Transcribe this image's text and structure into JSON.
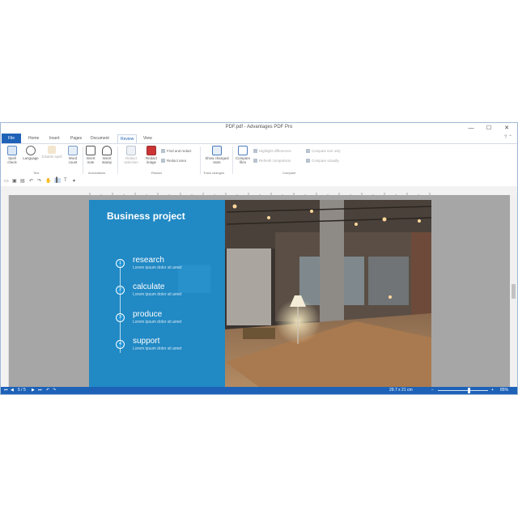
{
  "window": {
    "title": "PDF.pdf - Advantages PDF Pro",
    "controls": [
      "—",
      "☐",
      "✕"
    ]
  },
  "tabs": [
    "File",
    "Home",
    "Insert",
    "Pages",
    "Document",
    "Review",
    "View"
  ],
  "active_tab": "Review",
  "ribbon": {
    "spell_check": "Spell check",
    "language": "Language",
    "disable_spell": "Disable spell",
    "word_count": "Word count",
    "insert_note": "Insert note",
    "insert_stamp": "Insert stamp",
    "redact_selection": "Redact selection",
    "redact_image": "Redact image",
    "find_and_redact": "Find and redact",
    "redact_area": "Redact area",
    "show_changes": "Show changed texts",
    "compare_files": "Compare files",
    "highlight_differences": "Highlight differences",
    "refresh_comparison": "Refresh comparison",
    "compare_text_only": "Compare text only",
    "compare_visually": "Compare visually",
    "groups": {
      "text": "Text",
      "annotations": "Annotations",
      "redact": "Redact",
      "track_changes": "Track changes",
      "compare": "Compare"
    }
  },
  "document": {
    "title": "Business project",
    "steps": [
      {
        "num": "1",
        "heading": "research",
        "sub": "Lorem ipsum dolor sit amet"
      },
      {
        "num": "2",
        "heading": "calculate",
        "sub": "Lorem ipsum dolor sit amet"
      },
      {
        "num": "3",
        "heading": "produce",
        "sub": "Lorem ipsum dolor sit amet"
      },
      {
        "num": "4",
        "heading": "support",
        "sub": "Lorem ipsum dolor sit amet"
      }
    ]
  },
  "status": {
    "page": "5 / 5",
    "size": "29.7 x 21 cm",
    "zoom": "85%"
  },
  "colors": {
    "accent": "#1e62b8",
    "panel": "#1a96dc"
  }
}
